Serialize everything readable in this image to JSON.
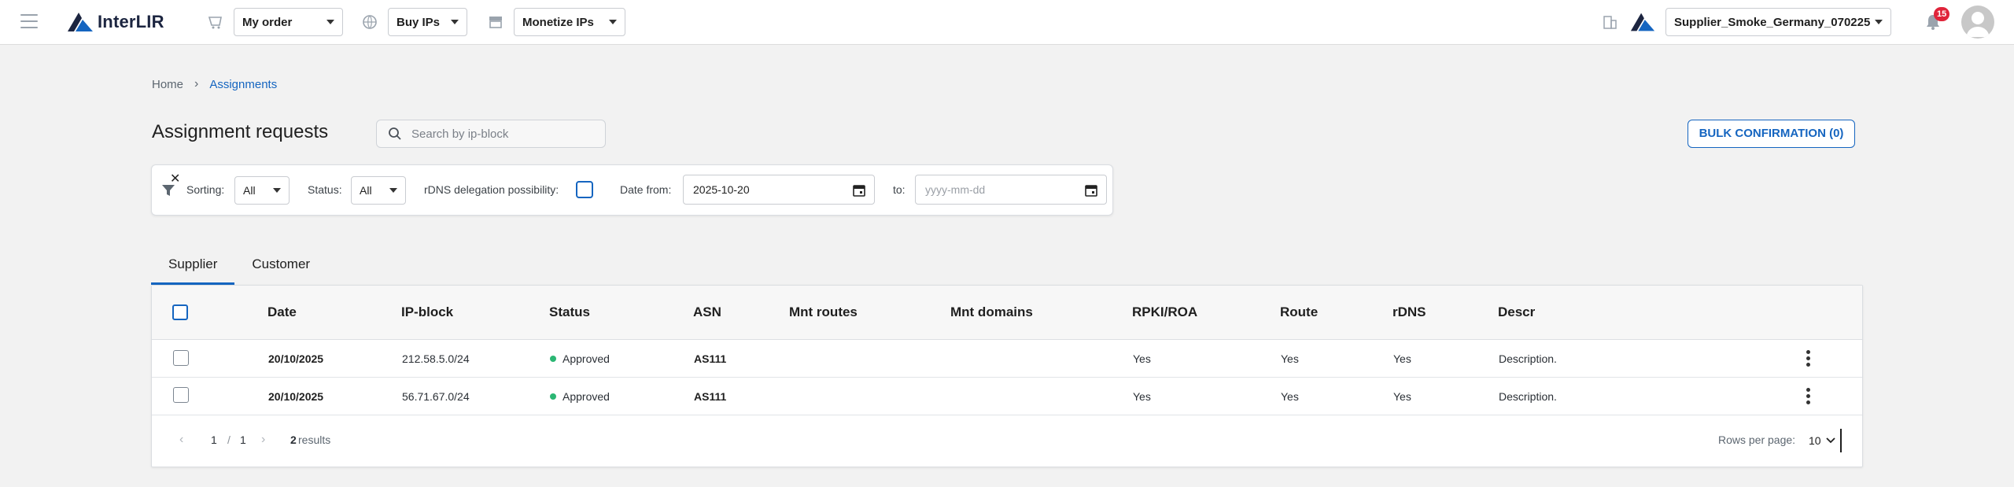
{
  "header": {
    "logo_text": "InterLIR",
    "my_order_label": "My order",
    "buy_ips_label": "Buy IPs",
    "monetize_ips_label": "Monetize IPs",
    "account_label": "Supplier_Smoke_Germany_070225",
    "notification_count": "15"
  },
  "breadcrumb": {
    "home": "Home",
    "separator": "›",
    "current": "Assignments"
  },
  "page": {
    "title": "Assignment requests",
    "search_placeholder": "Search by ip-block",
    "bulk_button": "BULK CONFIRMATION (0)"
  },
  "filters": {
    "sorting_label": "Sorting:",
    "sorting_value": "All",
    "status_label": "Status:",
    "status_value": "All",
    "rdns_label": "rDNS delegation possibility:",
    "date_from_label": "Date from:",
    "date_from_value": "2025-10-20",
    "to_label": "to:",
    "date_to_placeholder": "yyyy-mm-dd"
  },
  "tabs": [
    "Supplier",
    "Customer"
  ],
  "table": {
    "columns": [
      "Date",
      "IP-block",
      "Status",
      "ASN",
      "Mnt routes",
      "Mnt domains",
      "RPKI/ROA",
      "Route",
      "rDNS",
      "Descr"
    ],
    "rows": [
      {
        "date": "20/10/2025",
        "ip_block": "212.58.5.0/24",
        "status": "Approved",
        "asn": "AS111",
        "mnt_routes": "",
        "mnt_domains": "",
        "rpki": "Yes",
        "route": "Yes",
        "rdns": "Yes",
        "descr": "Description."
      },
      {
        "date": "20/10/2025",
        "ip_block": "56.71.67.0/24",
        "status": "Approved",
        "asn": "AS111",
        "mnt_routes": "",
        "mnt_domains": "",
        "rpki": "Yes",
        "route": "Yes",
        "rdns": "Yes",
        "descr": "Description."
      }
    ]
  },
  "pagination": {
    "prev_icon": "‹",
    "next_icon": "›",
    "current_page": "1",
    "separator": "/",
    "total_pages": "1",
    "results_count": "2",
    "results_label": "results",
    "rows_per_page_label": "Rows per page:",
    "rows_per_page_value": "10"
  },
  "colors": {
    "accent": "#1565c0",
    "approved": "#2bb673",
    "badge": "#e0243a"
  },
  "icons": [
    "menu-icon",
    "cart-icon",
    "globe-icon",
    "store-icon",
    "building-icon",
    "bell-icon",
    "filter-icon",
    "close-icon",
    "calendar-icon",
    "search-icon",
    "kebab-icon"
  ]
}
